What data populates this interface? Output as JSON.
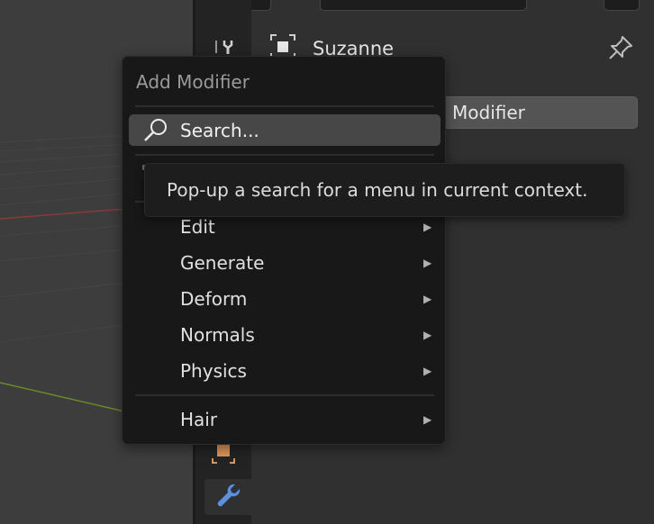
{
  "object": {
    "name": "Suzanne"
  },
  "properties": {
    "add_modifier_button": "Modifier"
  },
  "menu": {
    "title": "Add Modifier",
    "search_label": "Search...",
    "items": [
      {
        "label": "Edit",
        "has_submenu": true
      },
      {
        "label": "Generate",
        "has_submenu": true
      },
      {
        "label": "Deform",
        "has_submenu": true
      },
      {
        "label": "Normals",
        "has_submenu": true
      },
      {
        "label": "Physics",
        "has_submenu": true
      },
      {
        "label": "Hair",
        "has_submenu": true
      }
    ],
    "submenu_arrow": "▶"
  },
  "tooltip": {
    "text": "Pop-up a search for a menu in current context."
  },
  "icons": {
    "search": "search-icon",
    "pin": "pin-icon",
    "object": "object-icon",
    "modifier_tab": "wrench-icon",
    "tool_tab": "tool-icon",
    "material_tab": "object-data-icon"
  },
  "colors": {
    "accent_blue": "#5c8fe0",
    "orange": "#d9955a",
    "menu_bg": "#181818",
    "highlight": "#474747"
  }
}
